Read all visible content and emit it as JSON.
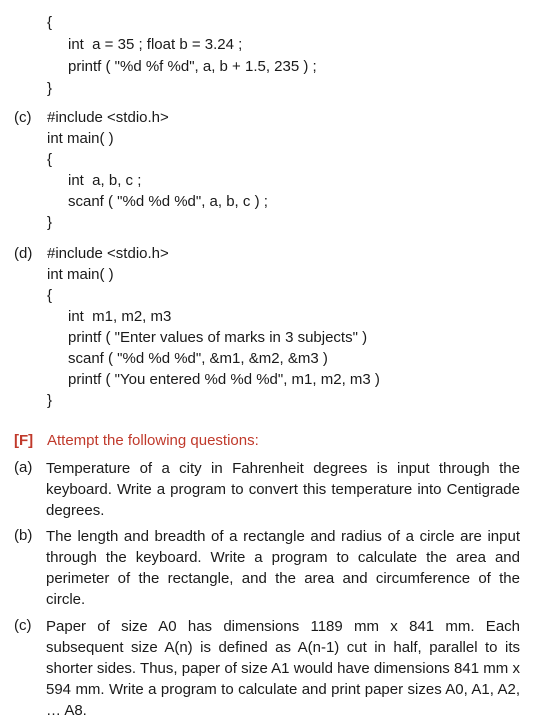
{
  "block_top": {
    "open": "{",
    "l1": "int  a = 35 ; float b = 3.24 ;",
    "l2": "printf ( \"%d %f %d\", a, b + 1.5, 235 ) ;",
    "close": "}"
  },
  "c": {
    "label": "(c)",
    "l1": "#include <stdio.h>",
    "l2": "int main( )",
    "open": "{",
    "l3": "int  a, b, c ;",
    "l4": "scanf ( \"%d %d %d\", a, b, c ) ;",
    "close": "}"
  },
  "d": {
    "label": "(d)",
    "l1": "#include <stdio.h>",
    "l2": "int main( )",
    "open": "{",
    "l3": "int  m1, m2, m3",
    "l4": "printf ( \"Enter values of marks in 3 subjects\" )",
    "l5": "scanf ( \"%d %d %d\", &m1, &m2, &m3 )",
    "l6": "printf ( \"You entered %d %d %d\", m1, m2, m3 )",
    "close": "}"
  },
  "section_f": {
    "tag": "[F]",
    "title": "Attempt the following questions:"
  },
  "questions": [
    {
      "label": "(a)",
      "text": "Temperature of a city in Fahrenheit degrees is input through the keyboard. Write a program to convert this temperature into Centigrade degrees."
    },
    {
      "label": "(b)",
      "text": "The length and breadth of a rectangle and radius of a circle are input through the keyboard. Write a program to calculate the area and perimeter of the rectangle, and the area and circumference of the circle."
    },
    {
      "label": "(c)",
      "text": "Paper of size A0 has dimensions 1189 mm x 841 mm. Each subsequent size A(n) is defined as A(n-1) cut in half, parallel to its shorter sides. Thus, paper of size A1 would have dimensions 841 mm x 594 mm. Write a program to calculate and print paper sizes A0, A1, A2, … A8."
    }
  ],
  "colors": {
    "accent": "#c0392b",
    "text": "#1a1a1a"
  }
}
